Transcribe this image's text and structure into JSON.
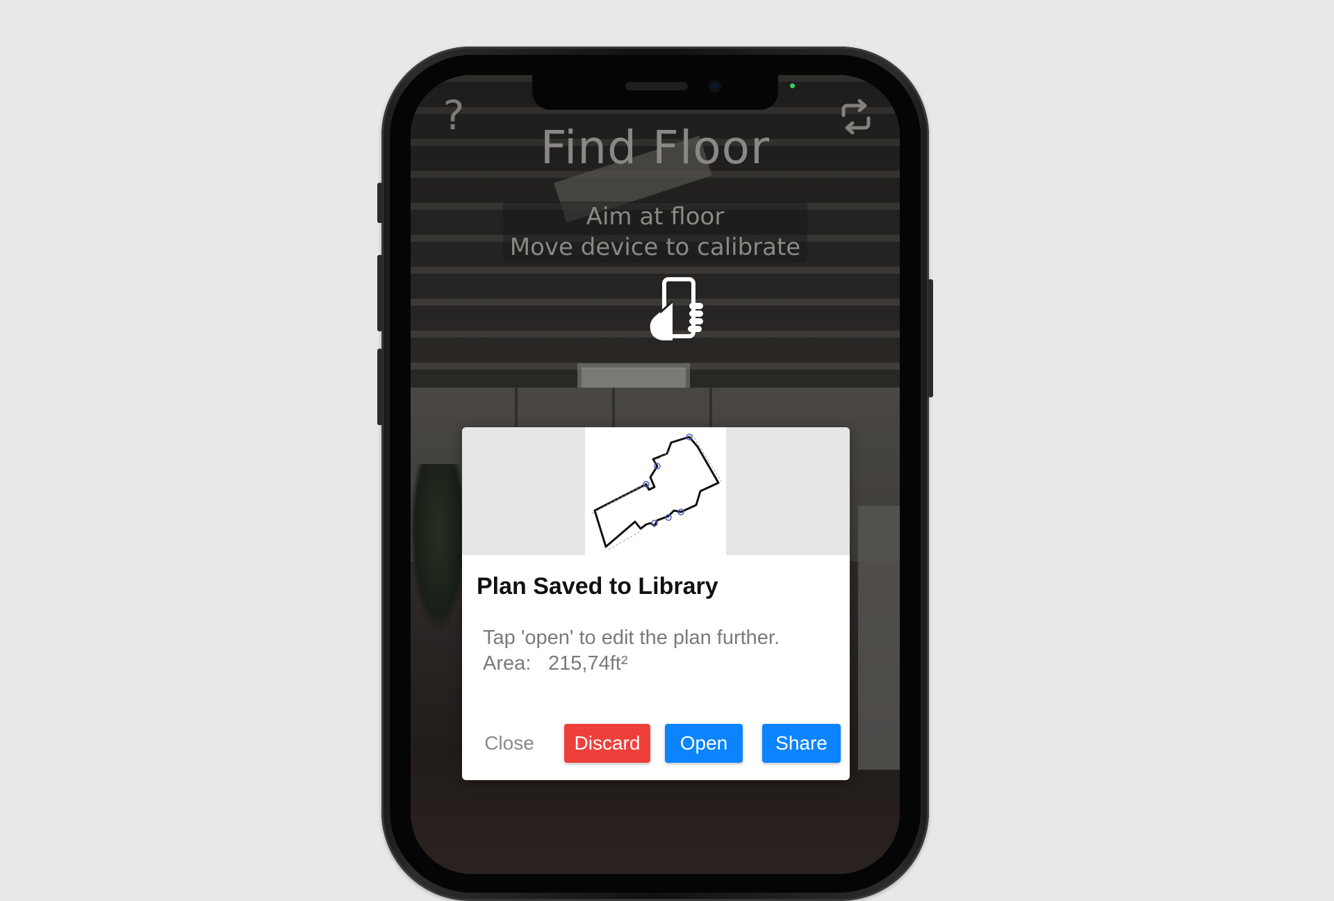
{
  "app": {
    "help_label": "?",
    "title": "Find Floor",
    "instructions": {
      "line1": "Aim at floor",
      "line2": "Move device to calibrate"
    },
    "icons": {
      "help": "question-mark-icon",
      "refresh": "refresh-camera-icon",
      "hold_phone": "hand-holding-phone-icon"
    }
  },
  "dialog": {
    "title": "Plan Saved to Library",
    "message": "Tap 'open' to edit the plan further.",
    "area_label": "Area:",
    "area_value": "215,74ft²",
    "buttons": {
      "close": "Close",
      "discard": "Discard",
      "open": "Open",
      "share": "Share"
    },
    "colors": {
      "discard": "#ef3f3b",
      "primary": "#0c84ff"
    }
  }
}
